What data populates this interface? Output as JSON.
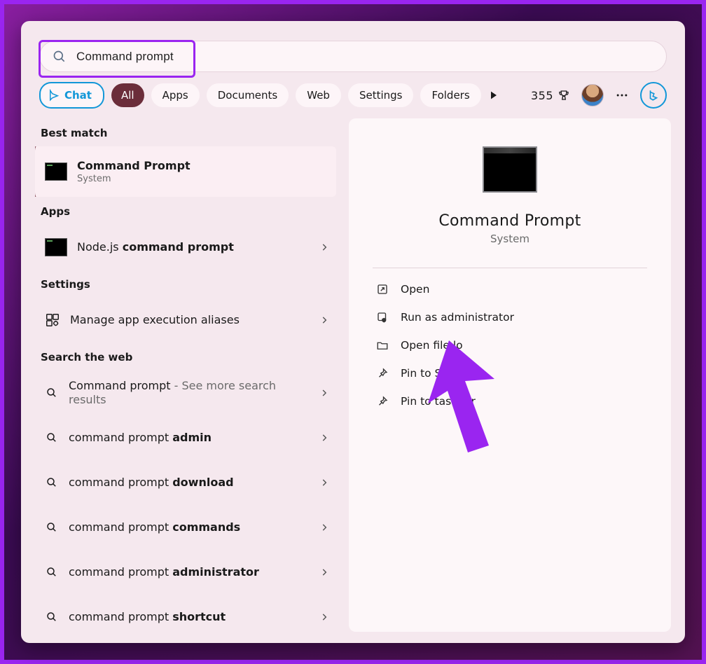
{
  "search": {
    "value": "Command prompt"
  },
  "filters": {
    "chat": "Chat",
    "all": "All",
    "apps": "Apps",
    "documents": "Documents",
    "web": "Web",
    "settings": "Settings",
    "folders": "Folders"
  },
  "points": "355",
  "left": {
    "best_match_head": "Best match",
    "best": {
      "title": "Command Prompt",
      "sub": "System"
    },
    "apps_head": "Apps",
    "apps": [
      {
        "prefix": "Node.js ",
        "bold": "command prompt"
      }
    ],
    "settings_head": "Settings",
    "settings": [
      {
        "label": "Manage app execution aliases"
      }
    ],
    "web_head": "Search the web",
    "web": [
      {
        "prefix": "Command prompt",
        "suffix_muted": " - See more search results"
      },
      {
        "prefix": "command prompt ",
        "bold": "admin"
      },
      {
        "prefix": "command prompt ",
        "bold": "download"
      },
      {
        "prefix": "command prompt ",
        "bold": "commands"
      },
      {
        "prefix": "command prompt ",
        "bold": "administrator"
      },
      {
        "prefix": "command prompt ",
        "bold": "shortcut"
      }
    ]
  },
  "detail": {
    "title": "Command Prompt",
    "sub": "System",
    "actions": {
      "open": "Open",
      "run_admin": "Run as administrator",
      "open_loc": "Open file lo",
      "pin_start": "Pin to Start",
      "pin_taskbar": "Pin to taskbar"
    }
  }
}
